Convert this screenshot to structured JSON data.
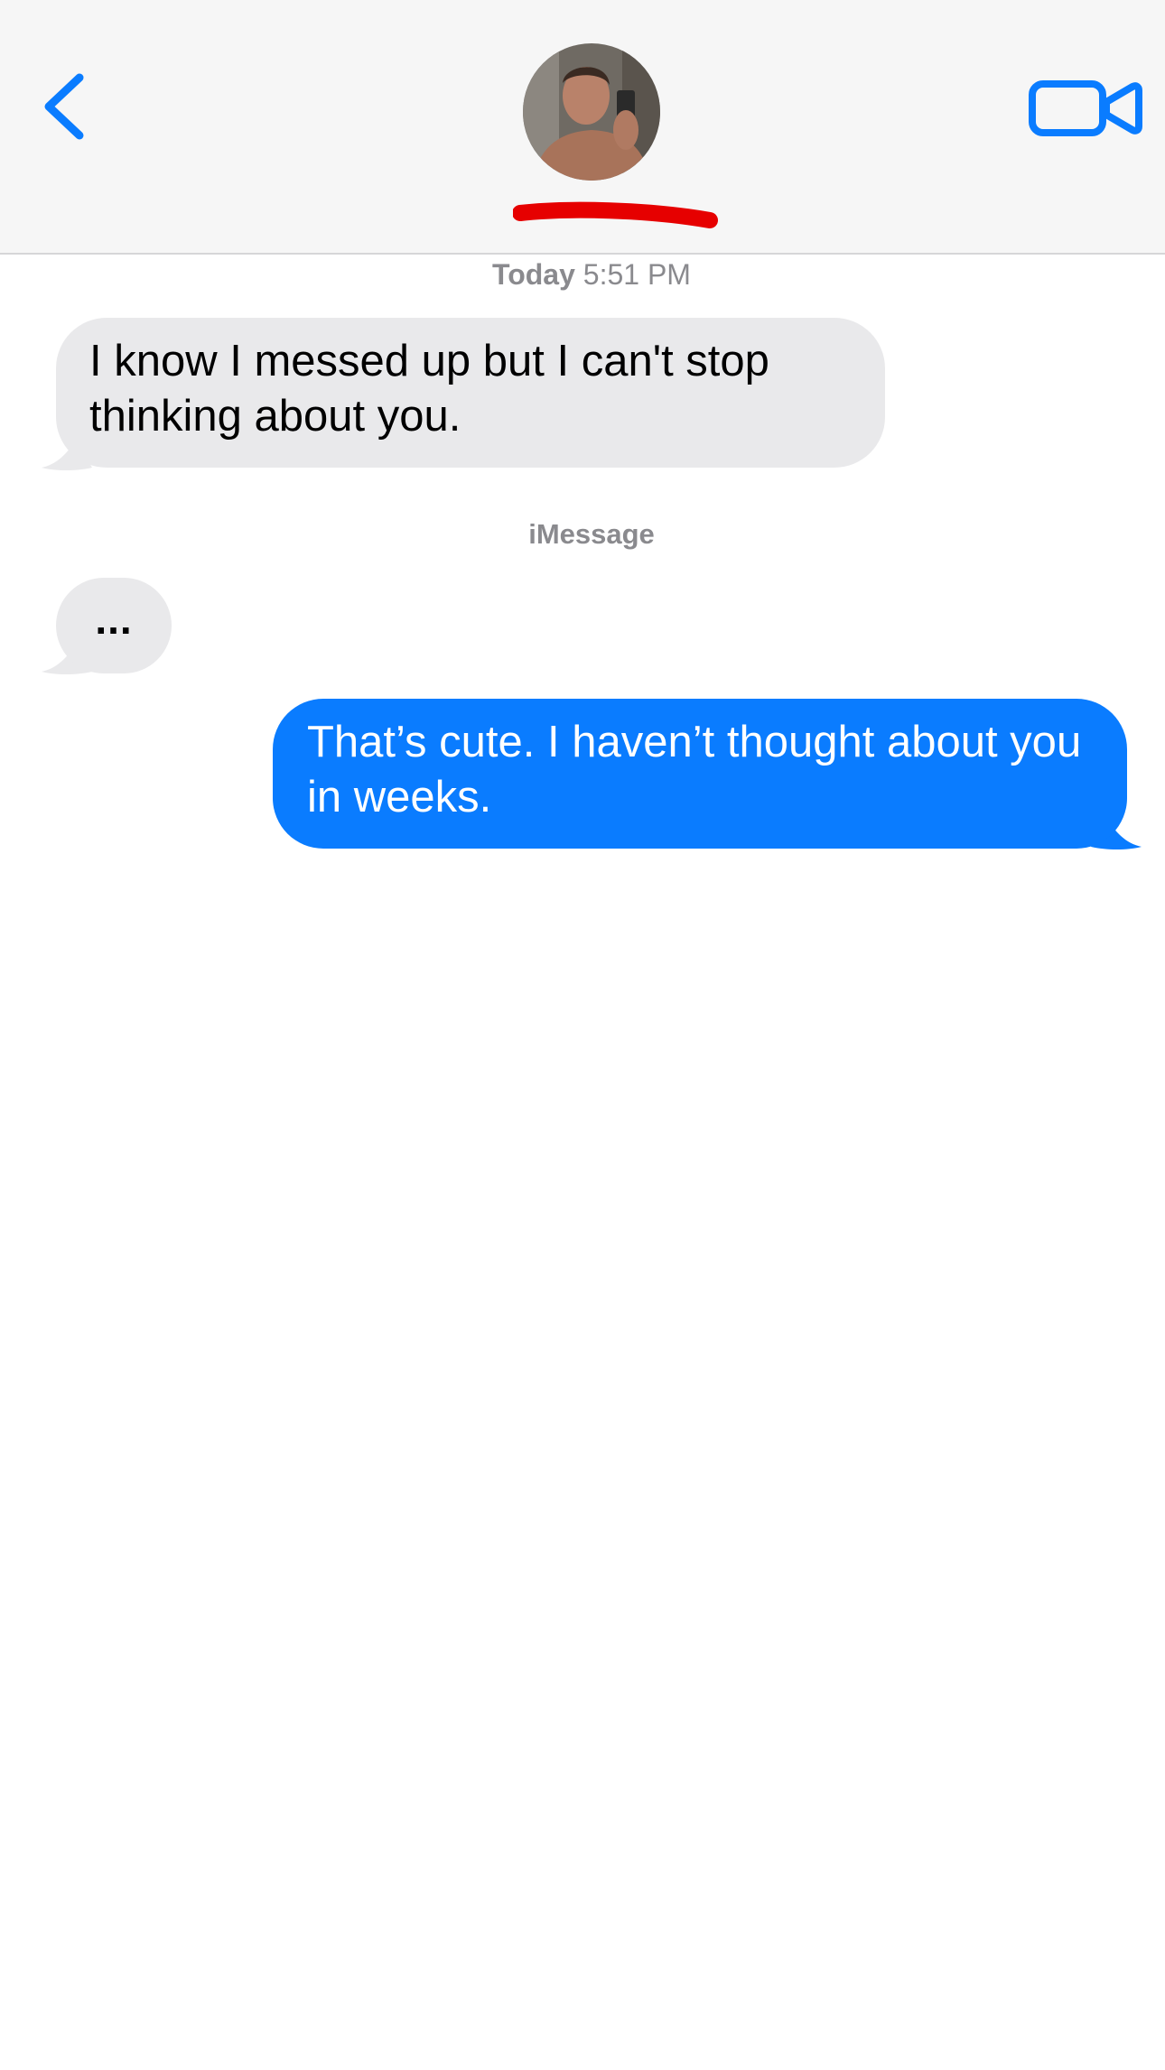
{
  "header": {
    "back_icon": "chevron-left-icon",
    "video_icon": "video-camera-icon",
    "accent_color": "#0a7cff",
    "redaction_color": "#e60000"
  },
  "conversation": {
    "timestamp_day": "Today",
    "timestamp_time": "5:51 PM",
    "service_label": "iMessage",
    "messages": [
      {
        "direction": "incoming",
        "text": "I know I messed up but I can't stop thinking about you."
      },
      {
        "direction": "incoming",
        "text": "..."
      },
      {
        "direction": "outgoing",
        "text": "That’s cute. I haven’t thought about you in weeks."
      }
    ],
    "incoming_bubble_color": "#e9e9eb",
    "outgoing_bubble_color": "#0a7cff"
  }
}
